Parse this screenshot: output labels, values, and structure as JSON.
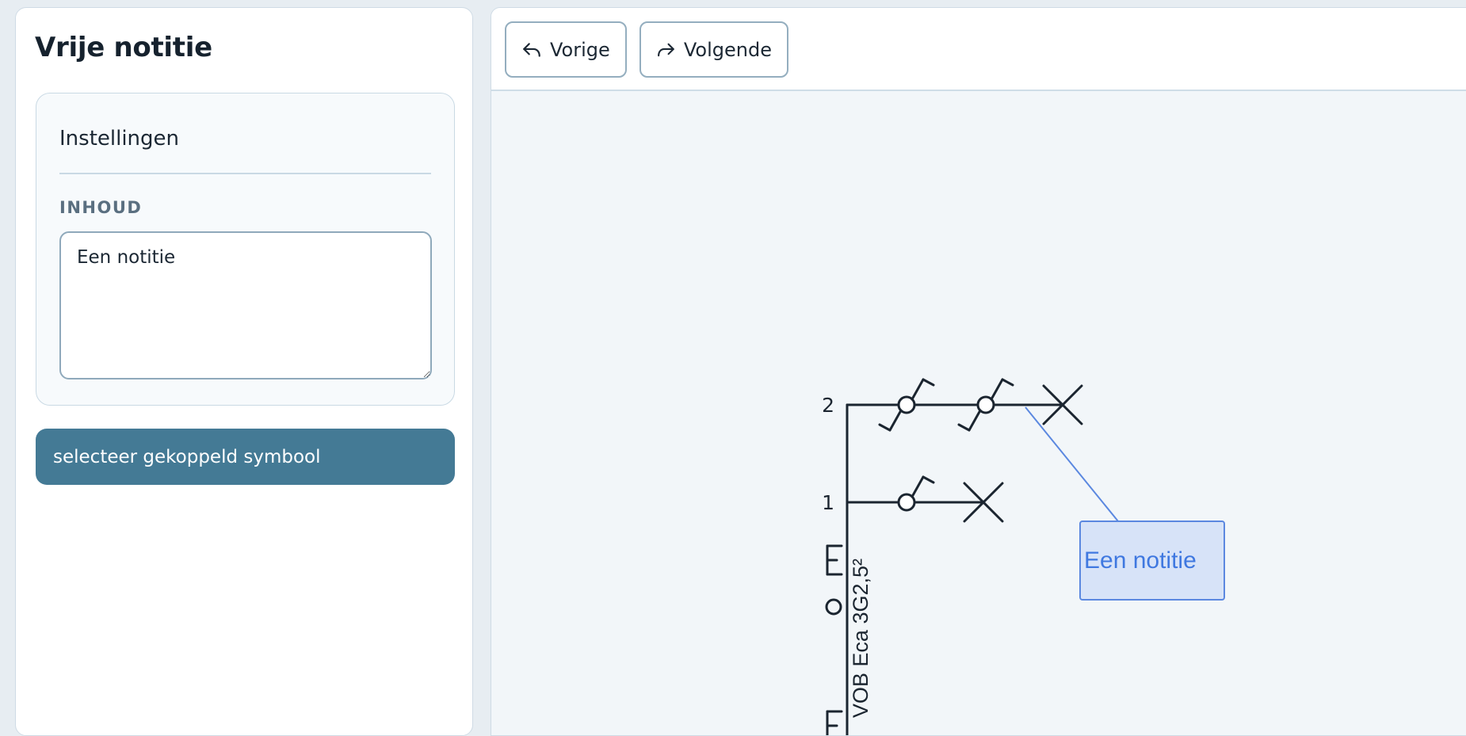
{
  "sidebar": {
    "title": "Vrije notitie",
    "settings": {
      "title": "Instellingen",
      "content_label": "INHOUD",
      "content_value": "Een notitie"
    },
    "link_button_label": "selecteer gekoppeld symbool"
  },
  "toolbar": {
    "undo_label": "Vorige",
    "redo_label": "Volgende"
  },
  "diagram": {
    "circuit_numbers": [
      "2",
      "1"
    ],
    "cable_label": "VOB Eca 3G2,5²",
    "note_text": "Een notitie"
  },
  "colors": {
    "accent_button": "#447a95",
    "note_fill": "#d7e3f8",
    "note_border": "#5b88e0",
    "note_text": "#3f78e0",
    "symbol_stroke": "#1b2530"
  }
}
